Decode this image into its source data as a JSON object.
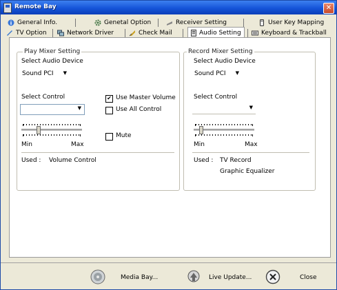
{
  "window": {
    "title": "Remote Bay"
  },
  "tabs_row1": [
    {
      "label": "General Info.",
      "icon": "info-icon"
    },
    {
      "label": "Genetal Option",
      "icon": "gear-icon"
    },
    {
      "label": "Receiver Setting",
      "icon": "receiver-icon"
    },
    {
      "label": "User Key Mapping",
      "icon": "remote-icon"
    }
  ],
  "tabs_row2": [
    {
      "label": "TV Option",
      "icon": "tv-icon"
    },
    {
      "label": "Network Driver",
      "icon": "network-icon"
    },
    {
      "label": "Check Mail",
      "icon": "mail-icon"
    },
    {
      "label": "Audio Setting",
      "icon": "audio-icon",
      "active": true
    },
    {
      "label": "Keyboard & Trackball",
      "icon": "keyboard-icon"
    }
  ],
  "play": {
    "legend": "Play Mixer Setting",
    "device_label": "Select Audio Device",
    "device_value": "Sound PCI",
    "control_label": "Select Control",
    "control_value": "",
    "use_master_label": "Use Master Volume",
    "use_master_checked": true,
    "use_all_label": "Use All Control",
    "use_all_checked": false,
    "mute_label": "Mute",
    "mute_checked": false,
    "min_label": "Min",
    "max_label": "Max",
    "used_label": "Used :",
    "used_value": "Volume Control"
  },
  "record": {
    "legend": "Record Mixer Setting",
    "device_label": "Select Audio Device",
    "device_value": "Sound PCI",
    "control_label": "Select Control",
    "control_value": "",
    "min_label": "Min",
    "max_label": "Max",
    "used_label": "Used :",
    "used_value_1": "TV Record",
    "used_value_2": "Graphic Equalizer"
  },
  "footer": {
    "media_bay": "Media Bay...",
    "live_update": "Live Update...",
    "close": "Close"
  },
  "colors": {
    "titlebar": "#1554d8",
    "dialog": "#ece9d8",
    "close": "#c74a2a"
  }
}
